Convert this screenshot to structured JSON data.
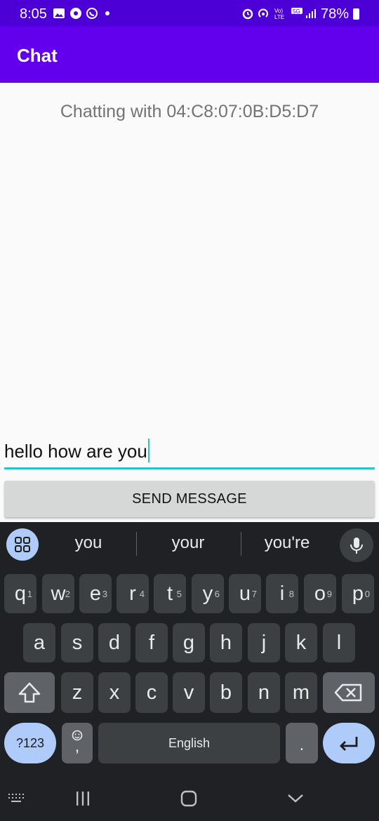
{
  "status": {
    "time": "8:05",
    "battery": "78%"
  },
  "appbar": {
    "title": "Chat"
  },
  "chat": {
    "header": "Chatting with 04:C8:07:0B:D5:D7"
  },
  "composer": {
    "value": "hello how are you",
    "send_label": "SEND MESSAGE"
  },
  "keyboard": {
    "suggestions": [
      "you",
      "your",
      "you're"
    ],
    "row1": [
      {
        "k": "q",
        "h": "1"
      },
      {
        "k": "w",
        "h": "2"
      },
      {
        "k": "e",
        "h": "3"
      },
      {
        "k": "r",
        "h": "4"
      },
      {
        "k": "t",
        "h": "5"
      },
      {
        "k": "y",
        "h": "6"
      },
      {
        "k": "u",
        "h": "7"
      },
      {
        "k": "i",
        "h": "8"
      },
      {
        "k": "o",
        "h": "9"
      },
      {
        "k": "p",
        "h": "0"
      }
    ],
    "row2": [
      "a",
      "s",
      "d",
      "f",
      "g",
      "h",
      "j",
      "k",
      "l"
    ],
    "row3": [
      "z",
      "x",
      "c",
      "v",
      "b",
      "n",
      "m"
    ],
    "symbols_label": "?123",
    "comma_label": ",",
    "space_label": "English",
    "period_label": "."
  },
  "colors": {
    "status_bar": "#4d00d6",
    "app_bar": "#6200ee",
    "accent": "#26c6c6",
    "keyboard_bg": "#202124",
    "key": "#3c4043",
    "key_blue": "#aecbfa"
  }
}
